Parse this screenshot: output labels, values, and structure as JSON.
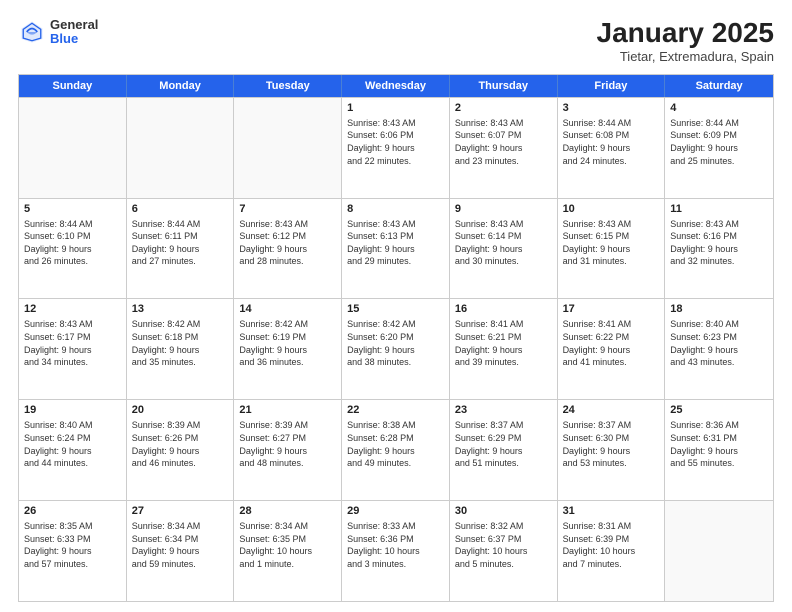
{
  "header": {
    "logo_general": "General",
    "logo_blue": "Blue",
    "month_title": "January 2025",
    "location": "Tietar, Extremadura, Spain"
  },
  "weekdays": [
    "Sunday",
    "Monday",
    "Tuesday",
    "Wednesday",
    "Thursday",
    "Friday",
    "Saturday"
  ],
  "rows": [
    [
      {
        "day": "",
        "info": ""
      },
      {
        "day": "",
        "info": ""
      },
      {
        "day": "",
        "info": ""
      },
      {
        "day": "1",
        "info": "Sunrise: 8:43 AM\nSunset: 6:06 PM\nDaylight: 9 hours\nand 22 minutes."
      },
      {
        "day": "2",
        "info": "Sunrise: 8:43 AM\nSunset: 6:07 PM\nDaylight: 9 hours\nand 23 minutes."
      },
      {
        "day": "3",
        "info": "Sunrise: 8:44 AM\nSunset: 6:08 PM\nDaylight: 9 hours\nand 24 minutes."
      },
      {
        "day": "4",
        "info": "Sunrise: 8:44 AM\nSunset: 6:09 PM\nDaylight: 9 hours\nand 25 minutes."
      }
    ],
    [
      {
        "day": "5",
        "info": "Sunrise: 8:44 AM\nSunset: 6:10 PM\nDaylight: 9 hours\nand 26 minutes."
      },
      {
        "day": "6",
        "info": "Sunrise: 8:44 AM\nSunset: 6:11 PM\nDaylight: 9 hours\nand 27 minutes."
      },
      {
        "day": "7",
        "info": "Sunrise: 8:43 AM\nSunset: 6:12 PM\nDaylight: 9 hours\nand 28 minutes."
      },
      {
        "day": "8",
        "info": "Sunrise: 8:43 AM\nSunset: 6:13 PM\nDaylight: 9 hours\nand 29 minutes."
      },
      {
        "day": "9",
        "info": "Sunrise: 8:43 AM\nSunset: 6:14 PM\nDaylight: 9 hours\nand 30 minutes."
      },
      {
        "day": "10",
        "info": "Sunrise: 8:43 AM\nSunset: 6:15 PM\nDaylight: 9 hours\nand 31 minutes."
      },
      {
        "day": "11",
        "info": "Sunrise: 8:43 AM\nSunset: 6:16 PM\nDaylight: 9 hours\nand 32 minutes."
      }
    ],
    [
      {
        "day": "12",
        "info": "Sunrise: 8:43 AM\nSunset: 6:17 PM\nDaylight: 9 hours\nand 34 minutes."
      },
      {
        "day": "13",
        "info": "Sunrise: 8:42 AM\nSunset: 6:18 PM\nDaylight: 9 hours\nand 35 minutes."
      },
      {
        "day": "14",
        "info": "Sunrise: 8:42 AM\nSunset: 6:19 PM\nDaylight: 9 hours\nand 36 minutes."
      },
      {
        "day": "15",
        "info": "Sunrise: 8:42 AM\nSunset: 6:20 PM\nDaylight: 9 hours\nand 38 minutes."
      },
      {
        "day": "16",
        "info": "Sunrise: 8:41 AM\nSunset: 6:21 PM\nDaylight: 9 hours\nand 39 minutes."
      },
      {
        "day": "17",
        "info": "Sunrise: 8:41 AM\nSunset: 6:22 PM\nDaylight: 9 hours\nand 41 minutes."
      },
      {
        "day": "18",
        "info": "Sunrise: 8:40 AM\nSunset: 6:23 PM\nDaylight: 9 hours\nand 43 minutes."
      }
    ],
    [
      {
        "day": "19",
        "info": "Sunrise: 8:40 AM\nSunset: 6:24 PM\nDaylight: 9 hours\nand 44 minutes."
      },
      {
        "day": "20",
        "info": "Sunrise: 8:39 AM\nSunset: 6:26 PM\nDaylight: 9 hours\nand 46 minutes."
      },
      {
        "day": "21",
        "info": "Sunrise: 8:39 AM\nSunset: 6:27 PM\nDaylight: 9 hours\nand 48 minutes."
      },
      {
        "day": "22",
        "info": "Sunrise: 8:38 AM\nSunset: 6:28 PM\nDaylight: 9 hours\nand 49 minutes."
      },
      {
        "day": "23",
        "info": "Sunrise: 8:37 AM\nSunset: 6:29 PM\nDaylight: 9 hours\nand 51 minutes."
      },
      {
        "day": "24",
        "info": "Sunrise: 8:37 AM\nSunset: 6:30 PM\nDaylight: 9 hours\nand 53 minutes."
      },
      {
        "day": "25",
        "info": "Sunrise: 8:36 AM\nSunset: 6:31 PM\nDaylight: 9 hours\nand 55 minutes."
      }
    ],
    [
      {
        "day": "26",
        "info": "Sunrise: 8:35 AM\nSunset: 6:33 PM\nDaylight: 9 hours\nand 57 minutes."
      },
      {
        "day": "27",
        "info": "Sunrise: 8:34 AM\nSunset: 6:34 PM\nDaylight: 9 hours\nand 59 minutes."
      },
      {
        "day": "28",
        "info": "Sunrise: 8:34 AM\nSunset: 6:35 PM\nDaylight: 10 hours\nand 1 minute."
      },
      {
        "day": "29",
        "info": "Sunrise: 8:33 AM\nSunset: 6:36 PM\nDaylight: 10 hours\nand 3 minutes."
      },
      {
        "day": "30",
        "info": "Sunrise: 8:32 AM\nSunset: 6:37 PM\nDaylight: 10 hours\nand 5 minutes."
      },
      {
        "day": "31",
        "info": "Sunrise: 8:31 AM\nSunset: 6:39 PM\nDaylight: 10 hours\nand 7 minutes."
      },
      {
        "day": "",
        "info": ""
      }
    ]
  ]
}
